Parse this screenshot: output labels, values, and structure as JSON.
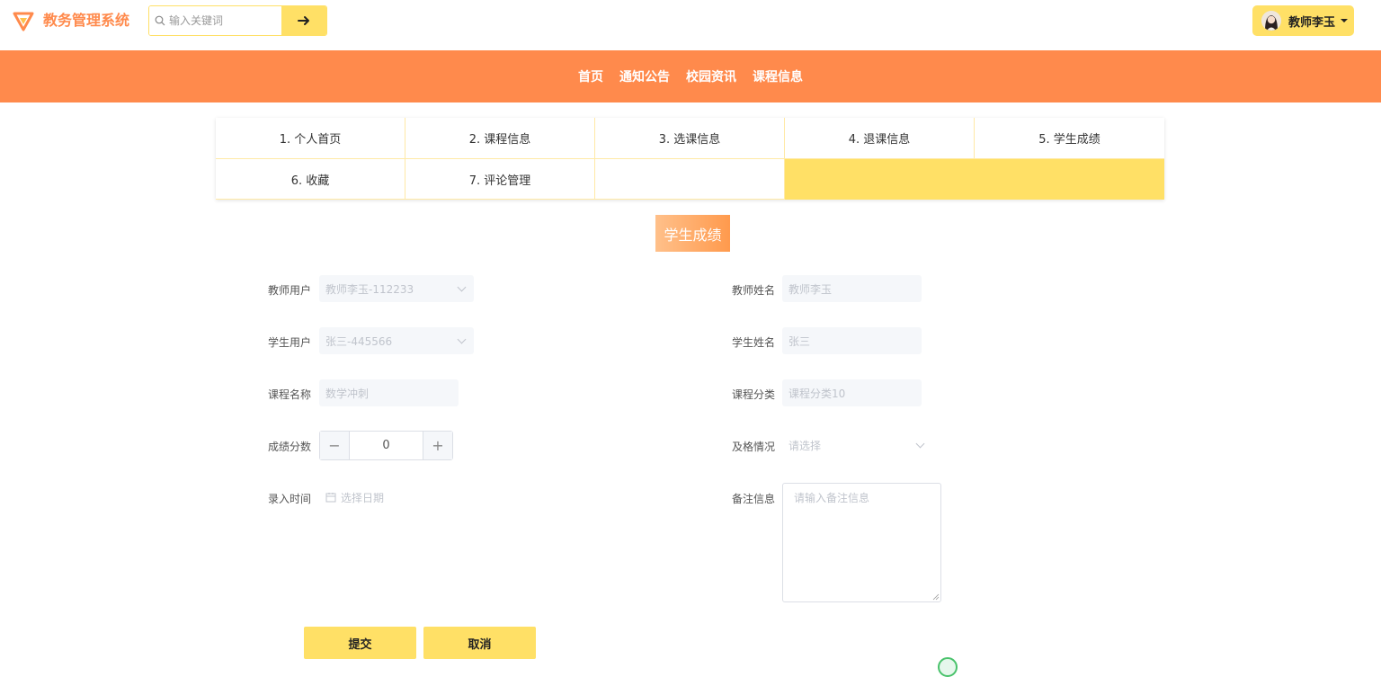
{
  "app": {
    "title": "教务管理系统"
  },
  "search": {
    "placeholder": "输入关键词"
  },
  "user": {
    "name": "教师李玉"
  },
  "nav": [
    "首页",
    "通知公告",
    "校园资讯",
    "课程信息"
  ],
  "tabs": [
    "1. 个人首页",
    "2. 课程信息",
    "3. 选课信息",
    "4. 退课信息",
    "5. 学生成绩",
    "6. 收藏",
    "7. 评论管理"
  ],
  "page_title": "学生成绩",
  "form": {
    "teacher_user": {
      "label": "教师用户",
      "value": "教师李玉-112233"
    },
    "teacher_name": {
      "label": "教师姓名",
      "value": "教师李玉"
    },
    "student_user": {
      "label": "学生用户",
      "value": "张三-445566"
    },
    "student_name": {
      "label": "学生姓名",
      "value": "张三"
    },
    "course_name": {
      "label": "课程名称",
      "value": "数学冲刺"
    },
    "course_category": {
      "label": "课程分类",
      "value": "课程分类10"
    },
    "score": {
      "label": "成绩分数",
      "value": "0",
      "minus": "−",
      "plus": "+"
    },
    "pass_status": {
      "label": "及格情况",
      "placeholder": "请选择"
    },
    "entry_time": {
      "label": "录入时间",
      "placeholder": "选择日期"
    },
    "remarks": {
      "label": "备注信息",
      "placeholder": "请输入备注信息"
    }
  },
  "buttons": {
    "submit": "提交",
    "cancel": "取消"
  },
  "colors": {
    "accent_orange": "#ff8a4c",
    "accent_yellow": "#ffe066"
  }
}
